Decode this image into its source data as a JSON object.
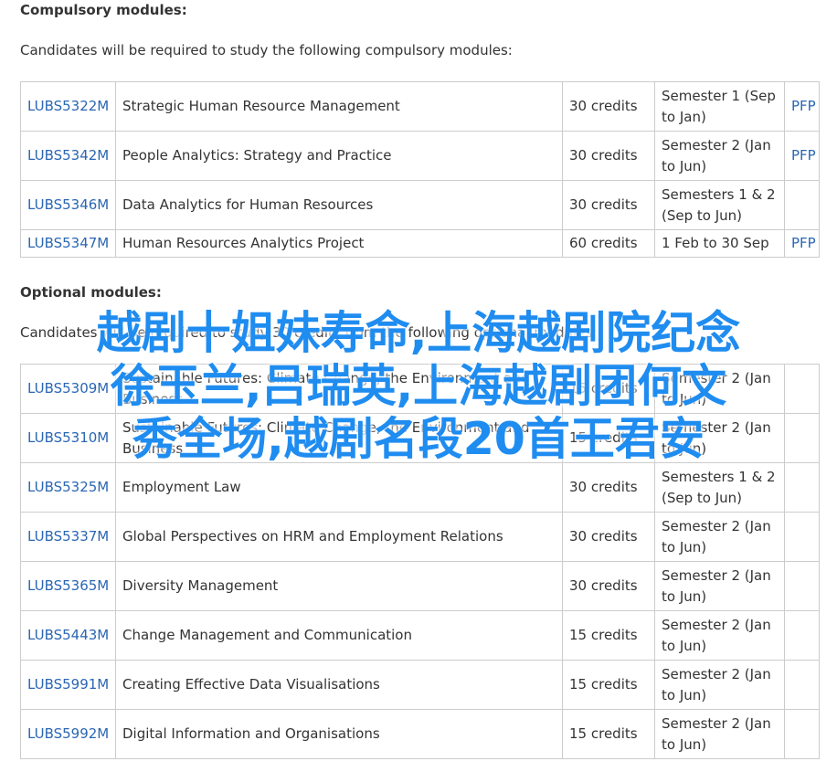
{
  "compulsory": {
    "heading": "Compulsory modules:",
    "intro": "Candidates will be required to study the following compulsory modules:",
    "rows": [
      {
        "code": "LUBS5322M",
        "title": "Strategic Human Resource Management",
        "credits": "30 credits",
        "semester": "Semester 1 (Sep to Jan)",
        "pfp": "PFP"
      },
      {
        "code": "LUBS5342M",
        "title": "People Analytics: Strategy and Practice",
        "credits": "30 credits",
        "semester": "Semester 2 (Jan to Jun)",
        "pfp": "PFP"
      },
      {
        "code": "LUBS5346M",
        "title": "Data Analytics for Human Resources",
        "credits": "30 credits",
        "semester": "Semesters 1 & 2 (Sep to Jun)",
        "pfp": ""
      },
      {
        "code": "LUBS5347M",
        "title": "Human Resources Analytics Project",
        "credits": "60 credits",
        "semester": "1 Feb to 30 Sep",
        "pfp": "PFP"
      }
    ]
  },
  "optional": {
    "heading": "Optional modules:",
    "intro": "Candidates will be required to study 30 credits from the following optional modules:",
    "rows": [
      {
        "code": "LUBS5309M",
        "title": "Sustainable Futures: Climate Change, the Environment and Business",
        "credits": "15 credits",
        "semester": "Semester 2 (Jan to Jun)",
        "pfp": ""
      },
      {
        "code": "LUBS5310M",
        "title": "Sustainable Futures: Climate Change, the Environment and Business",
        "credits": "15 credits",
        "semester": "Semester 2 (Jan to Jun)",
        "pfp": ""
      },
      {
        "code": "LUBS5325M",
        "title": "Employment Law",
        "credits": "30 credits",
        "semester": "Semesters 1 & 2 (Sep to Jun)",
        "pfp": ""
      },
      {
        "code": "LUBS5337M",
        "title": "Global Perspectives on HRM and Employment Relations",
        "credits": "30 credits",
        "semester": "Semester 2 (Jan to Jun)",
        "pfp": ""
      },
      {
        "code": "LUBS5365M",
        "title": "Diversity Management",
        "credits": "30 credits",
        "semester": "Semester 2 (Jan to Jun)",
        "pfp": ""
      },
      {
        "code": "LUBS5443M",
        "title": "Change Management and Communication",
        "credits": "15 credits",
        "semester": "Semester 2 (Jan to Jun)",
        "pfp": ""
      },
      {
        "code": "LUBS5991M",
        "title": "Creating Effective Data Visualisations",
        "credits": "15 credits",
        "semester": "Semester 2 (Jan to Jun)",
        "pfp": ""
      },
      {
        "code": "LUBS5992M",
        "title": "Digital Information and Organisations",
        "credits": "15 credits",
        "semester": "Semester 2 (Jan to Jun)",
        "pfp": ""
      }
    ]
  },
  "overlay": {
    "lines": [
      "越剧十姐妹寿命,上海越剧院纪念",
      "徐玉兰,吕瑞英,上海越剧团何文",
      "秀全场,越剧名段20首王君安"
    ],
    "color": "#1f8cf0"
  },
  "colors": {
    "link": "#2a66b3",
    "border": "#cccccc",
    "text": "#333333"
  }
}
